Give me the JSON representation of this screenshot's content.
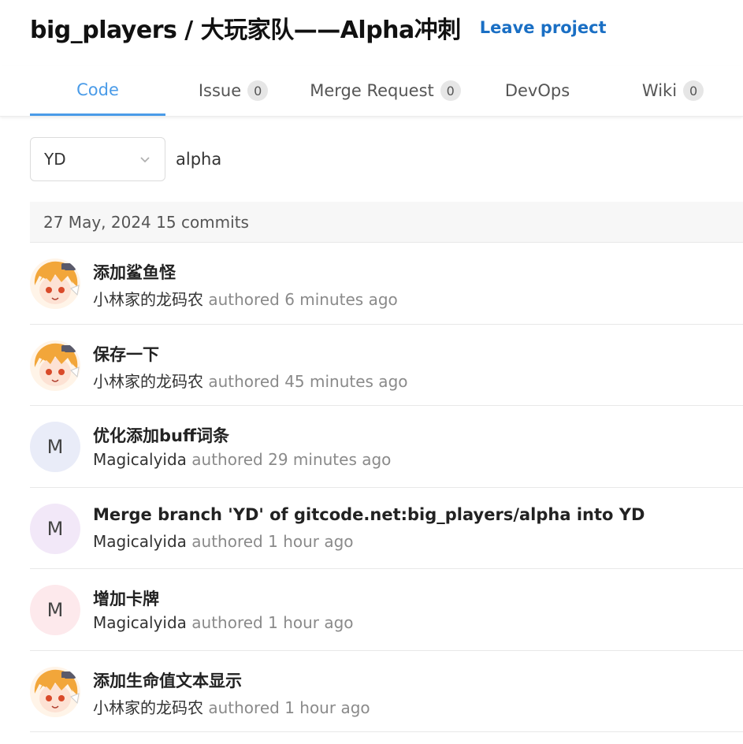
{
  "header": {
    "title": "big_players / 大玩家队——Alpha冲刺",
    "leave_label": "Leave project"
  },
  "tabs": [
    {
      "label": "Code",
      "count": null
    },
    {
      "label": "Issue",
      "count": "0"
    },
    {
      "label": "Merge Request",
      "count": "0"
    },
    {
      "label": "DevOps",
      "count": null
    },
    {
      "label": "Wiki",
      "count": "0"
    }
  ],
  "branch": {
    "selected": "YD"
  },
  "repo": {
    "name": "alpha"
  },
  "commit_group": {
    "date": "27 May, 2024",
    "count": "15 commits"
  },
  "commits": [
    {
      "message": "添加鲨鱼怪",
      "author": "小林家的龙码农",
      "action": "authored",
      "time": "6 minutes ago",
      "avatar": "anime-avatar"
    },
    {
      "message": "保存一下",
      "author": "小林家的龙码农",
      "action": "authored",
      "time": "45 minutes ago",
      "avatar": "anime-avatar"
    },
    {
      "message": "优化添加buff词条",
      "author": "Magicalyida",
      "action": "authored",
      "time": "29 minutes ago",
      "avatar": "M"
    },
    {
      "message": "Merge branch 'YD' of gitcode.net:big_players/alpha into YD",
      "author": "Magicalyida",
      "action": "authored",
      "time": "1 hour ago",
      "avatar": "M"
    },
    {
      "message": "增加卡牌",
      "author": "Magicalyida",
      "action": "authored",
      "time": "1 hour ago",
      "avatar": "M"
    },
    {
      "message": "添加生命值文本显示",
      "author": "小林家的龙码农",
      "action": "authored",
      "time": "1 hour ago",
      "avatar": "anime-avatar"
    }
  ],
  "colors": {
    "accent": "#4a9be8",
    "link": "#1a6fc4",
    "muted": "#8a8a8a"
  }
}
